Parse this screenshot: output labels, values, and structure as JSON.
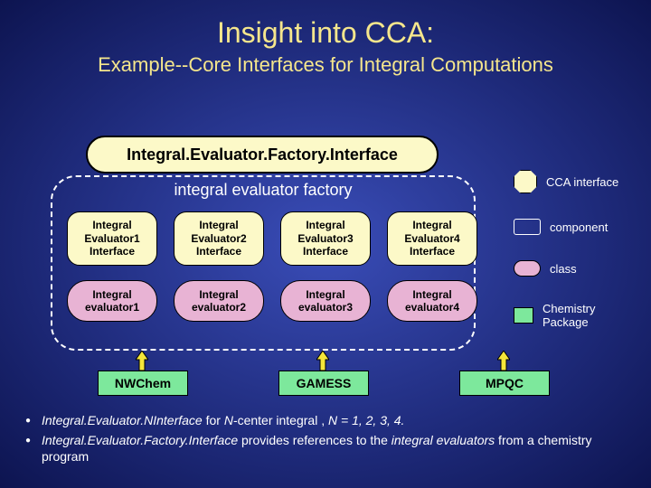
{
  "title": "Insight into CCA:",
  "subtitle": "Example--Core Interfaces for Integral Computations",
  "main_interface": "Integral.Evaluator.Factory.Interface",
  "factory_label": "integral evaluator factory",
  "interfaces": [
    "Integral Evaluator1 Interface",
    "Integral Evaluator2 Interface",
    "Integral Evaluator3 Interface",
    "Integral Evaluator4 Interface"
  ],
  "classes": [
    "Integral evaluator1",
    "Integral evaluator2",
    "Integral evaluator3",
    "Integral evaluator4"
  ],
  "packages": [
    "NWChem",
    "GAMESS",
    "MPQC"
  ],
  "legend": {
    "cca_interface": "CCA interface",
    "component": "component",
    "class": "class",
    "chemistry_package": "Chemistry Package"
  },
  "bullets": {
    "b1_pre": "Integral.Evaluator.NInterface",
    "b1_mid": " for ",
    "b1_em": "N",
    "b1_post": "-center integral , ",
    "b1_n": "N = 1, 2, 3, 4.",
    "b2_pre": "Integral.Evaluator.Factory.Interface",
    "b2_mid": " provides references to the ",
    "b2_em": "integral evaluators",
    "b2_post": " from a chemistry program"
  }
}
